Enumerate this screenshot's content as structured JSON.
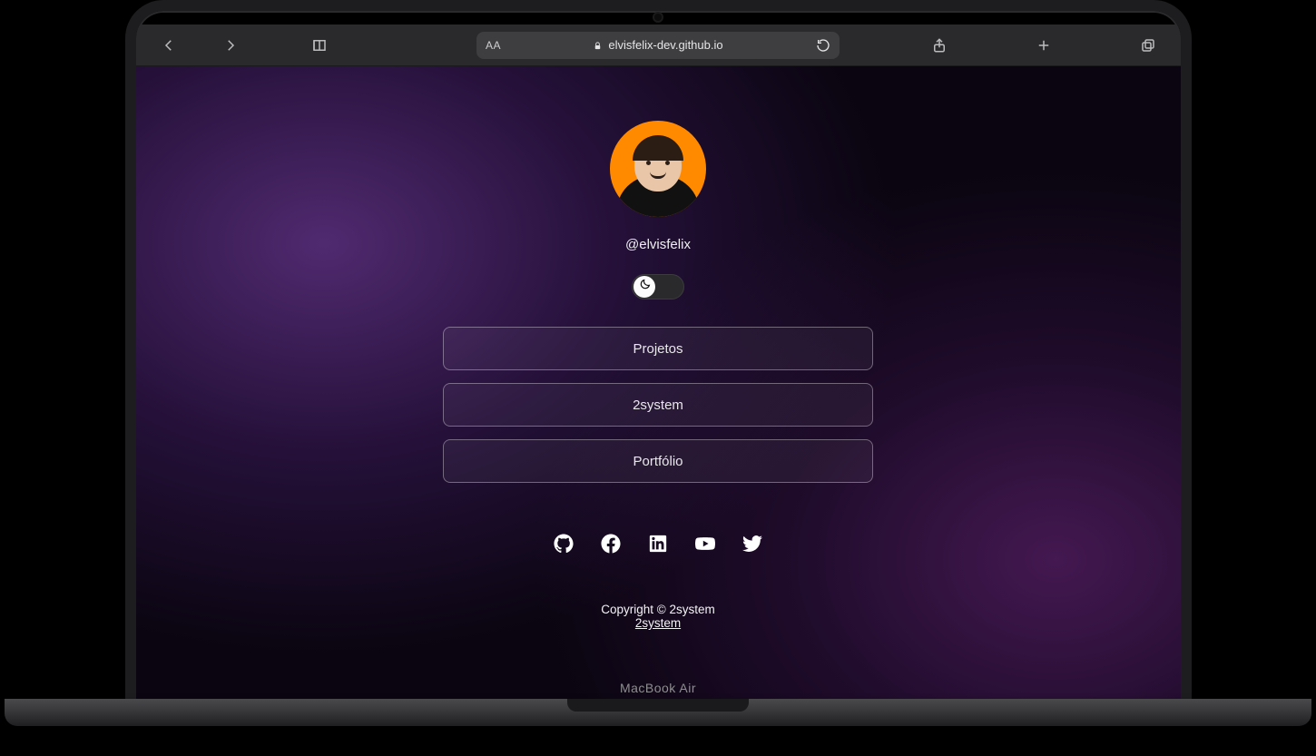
{
  "device_label": "MacBook Air",
  "toolbar": {
    "text_size_label": "AA",
    "address": "elvisfelix-dev.github.io"
  },
  "profile": {
    "handle": "@elvisfelix"
  },
  "links": [
    {
      "label": "Projetos"
    },
    {
      "label": "2system"
    },
    {
      "label": "Portfólio"
    }
  ],
  "socials": [
    {
      "name": "github"
    },
    {
      "name": "facebook"
    },
    {
      "name": "linkedin"
    },
    {
      "name": "youtube"
    },
    {
      "name": "twitter"
    }
  ],
  "footer": {
    "copyright": "Copyright © 2system",
    "link_label": "2system"
  }
}
